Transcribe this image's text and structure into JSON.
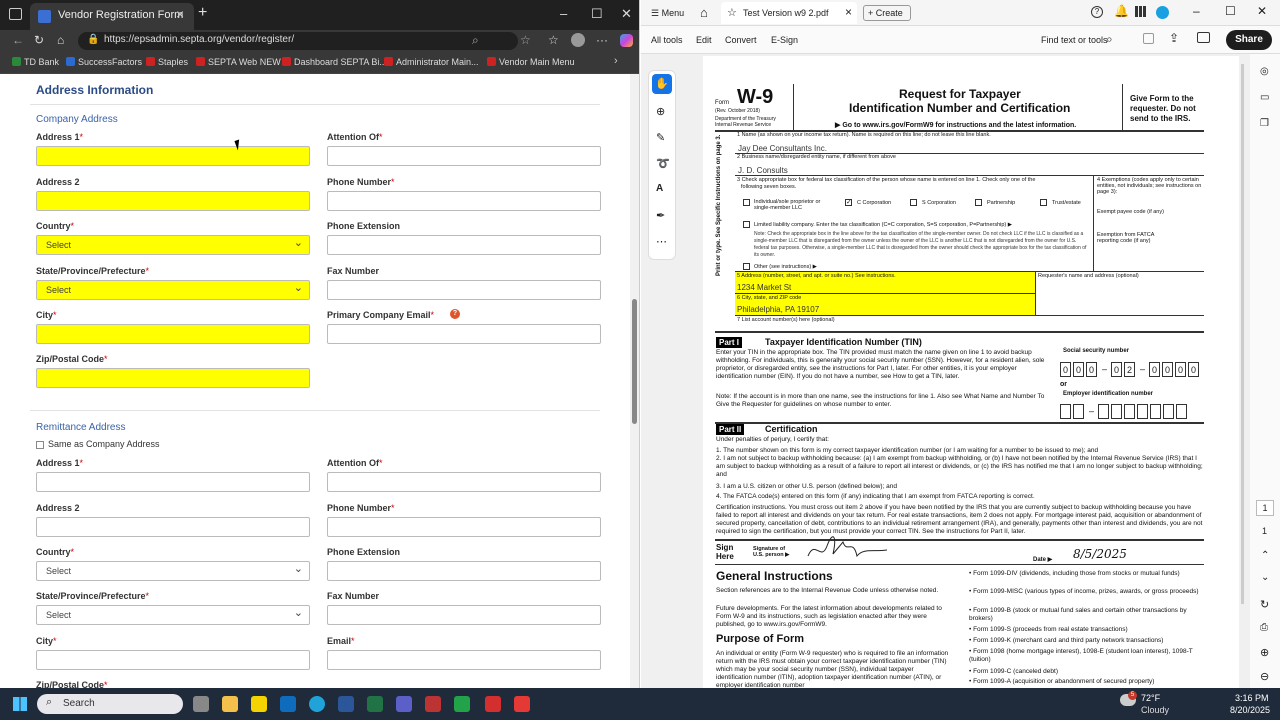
{
  "browser": {
    "tab_title": "Vendor Registration Form",
    "url": "https://epsadmin.septa.org/vendor/register/",
    "bookmarks": [
      "TD Bank",
      "SuccessFactors",
      "Staples",
      "SEPTA Web NEW",
      "Dashboard SEPTA Bi...",
      "Administrator Main...",
      "Vendor Main Menu"
    ],
    "window_controls": [
      "–",
      "☐",
      "✕"
    ]
  },
  "form": {
    "section_title": "Address Information",
    "company": {
      "heading": "Company Address",
      "address1": "Address 1",
      "attention": "Attention Of",
      "address2": "Address 2",
      "phone": "Phone Number",
      "country": "Country",
      "country_value": "Select",
      "phone_ext": "Phone Extension",
      "state": "State/Province/Prefecture",
      "state_value": "Select",
      "fax": "Fax Number",
      "city": "City",
      "email": "Primary Company Email",
      "zip": "Zip/Postal Code"
    },
    "remit": {
      "heading": "Remittance Address",
      "same_as": "Same as Company Address",
      "address1": "Address 1",
      "attention": "Attention Of",
      "address2": "Address 2",
      "phone": "Phone Number",
      "country": "Country",
      "country_value": "Select",
      "phone_ext": "Phone Extension",
      "state": "State/Province/Prefecture",
      "state_value": "Select",
      "fax": "Fax Number",
      "city": "City",
      "email": "Email",
      "zip": "Zip/Postal Code"
    },
    "required_mark": "*"
  },
  "pdf": {
    "menu": "Menu",
    "tab_title": "Test Version w9 2.pdf",
    "create": "Create",
    "tools": [
      "All tools",
      "Edit",
      "Convert",
      "E-Sign"
    ],
    "find": "Find text or tools",
    "share": "Share",
    "page_nums": [
      "1",
      "1"
    ],
    "w9": {
      "form": "Form",
      "w9": "W-9",
      "rev": "(Rev. October 2018)",
      "dept": "Department of the Treasury",
      "irs": "Internal Revenue Service",
      "title1": "Request for Taxpayer",
      "title2": "Identification Number and Certification",
      "goto": "▶ Go to www.irs.gov/FormW9 for instructions and the latest information.",
      "give": "Give Form to the requester. Do not send to the IRS.",
      "l1": "1  Name (as shown on your income tax return). Name is required on this line; do not leave this line blank.",
      "name": "Jay Dee Consultants Inc.",
      "l2": "2  Business name/disregarded entity name, if different from above",
      "business": "J. D. Consults",
      "l3": "3  Check appropriate box for federal tax classification of the person whose name is entered on line 1. Check only one of the",
      "l3b": "following seven boxes.",
      "c_indiv": "Individual/sole proprietor or single-member LLC",
      "c_ccorp": "C Corporation",
      "c_scorp": "S Corporation",
      "c_part": "Partnership",
      "c_trust": "Trust/estate",
      "llc": "Limited liability company. Enter the tax classification (C=C corporation, S=S corporation, P=Partnership) ▶",
      "other": "Other (see instructions) ▶",
      "l4": "4  Exemptions (codes apply only to certain entities, not individuals; see instructions on page 3):",
      "payee": "Exempt payee code (if any)",
      "fatca": "Exemption from FATCA reporting code (if any)",
      "l5": "5  Address (number, street, and apt. or suite no.) See instructions.",
      "address": "1234 Market St",
      "l6": "6  City, state, and ZIP code",
      "city": "Philadelphia, PA 19107",
      "l7": "7  List account number(s) here (optional)",
      "requester": "Requester's name and address (optional)",
      "side_label": "Print or type.  See Specific Instructions on page 3.",
      "part1": "Part I",
      "part1_title": "Taxpayer Identification Number (TIN)",
      "tin_text": "Enter your TIN in the appropriate box. The TIN provided must match the name given on line 1 to avoid backup withholding. For individuals, this is generally your social security number (SSN). However, for a resident alien, sole proprietor, or disregarded entity, see the instructions for Part I, later. For other entities, it is your employer identification number (EIN). If you do not have a number, see How to get a TIN, later.",
      "note": "Note: If the account is in more than one name, see the instructions for line 1. Also see What Name and Number To Give the Requester for guidelines on whose number to enter.",
      "ssn_label": "Social security number",
      "ssn": [
        "0",
        "0",
        "0",
        "0",
        "2",
        "0",
        "0",
        "0",
        "0"
      ],
      "or": "or",
      "ein_label": "Employer identification number",
      "part2": "Part II",
      "part2_title": "Certification",
      "cert_intro": "Under penalties of perjury, I certify that:",
      "cert1": "1. The number shown on this form is my correct taxpayer identification number (or I am waiting for a number to be issued to me); and",
      "cert2": "2. I am not subject to backup withholding because: (a) I am exempt from backup withholding, or (b) I have not been notified by the Internal Revenue Service (IRS) that I am subject to backup withholding as a result of a failure to report all interest or dividends, or (c) the IRS has notified me that I am no longer subject to backup withholding; and",
      "cert3": "3. I am a U.S. citizen or other U.S. person (defined below); and",
      "cert4": "4. The FATCA code(s) entered on this form (if any) indicating that I am exempt from FATCA reporting is correct.",
      "cert_instr": "Certification instructions. You must cross out item 2 above if you have been notified by the IRS that you are currently subject to backup withholding because you have failed to report all interest and dividends on your tax return. For real estate transactions, item 2 does not apply. For mortgage interest paid, acquisition or abandonment of secured property, cancellation of debt, contributions to an individual retirement arrangement (IRA), and generally, payments other than interest and dividends, you are not required to sign the certification, but you must provide your correct TIN. See the instructions for Part II, later.",
      "sign": "Sign Here",
      "sig_of": "Signature of U.S. person ▶",
      "date_lbl": "Date ▶",
      "date": "8/5/2025",
      "gen": "General Instructions",
      "gen_text": "Section references are to the Internal Revenue Code unless otherwise noted.",
      "future": "Future developments. For the latest information about developments related to Form W-9 and its instructions, such as legislation enacted after they were published, go to www.irs.gov/FormW9.",
      "purpose": "Purpose of Form",
      "purpose_text": "An individual or entity (Form W-9 requester) who is required to file an information return with the IRS must obtain your correct taxpayer identification number (TIN) which may be your social security number (SSN), individual taxpayer identification number (ITIN), adoption taxpayer identification number (ATIN), or employer identification number",
      "bullets": [
        "• Form 1099-DIV (dividends, including those from stocks or mutual funds)",
        "• Form 1099-MISC (various types of income, prizes, awards, or gross proceeds)",
        "• Form 1099-B (stock or mutual fund sales and certain other transactions by brokers)",
        "• Form 1099-S (proceeds from real estate transactions)",
        "• Form 1099-K (merchant card and third party network transactions)",
        "• Form 1098 (home mortgage interest), 1098-E (student loan interest), 1098-T (tuition)",
        "• Form 1099-C (canceled debt)",
        "• Form 1099-A (acquisition or abandonment of secured property)"
      ]
    }
  },
  "taskbar": {
    "search": "Search",
    "weather_temp": "72°F",
    "weather_desc": "Cloudy",
    "badge": "5",
    "time": "3:16 PM",
    "date": "8/20/2025"
  }
}
